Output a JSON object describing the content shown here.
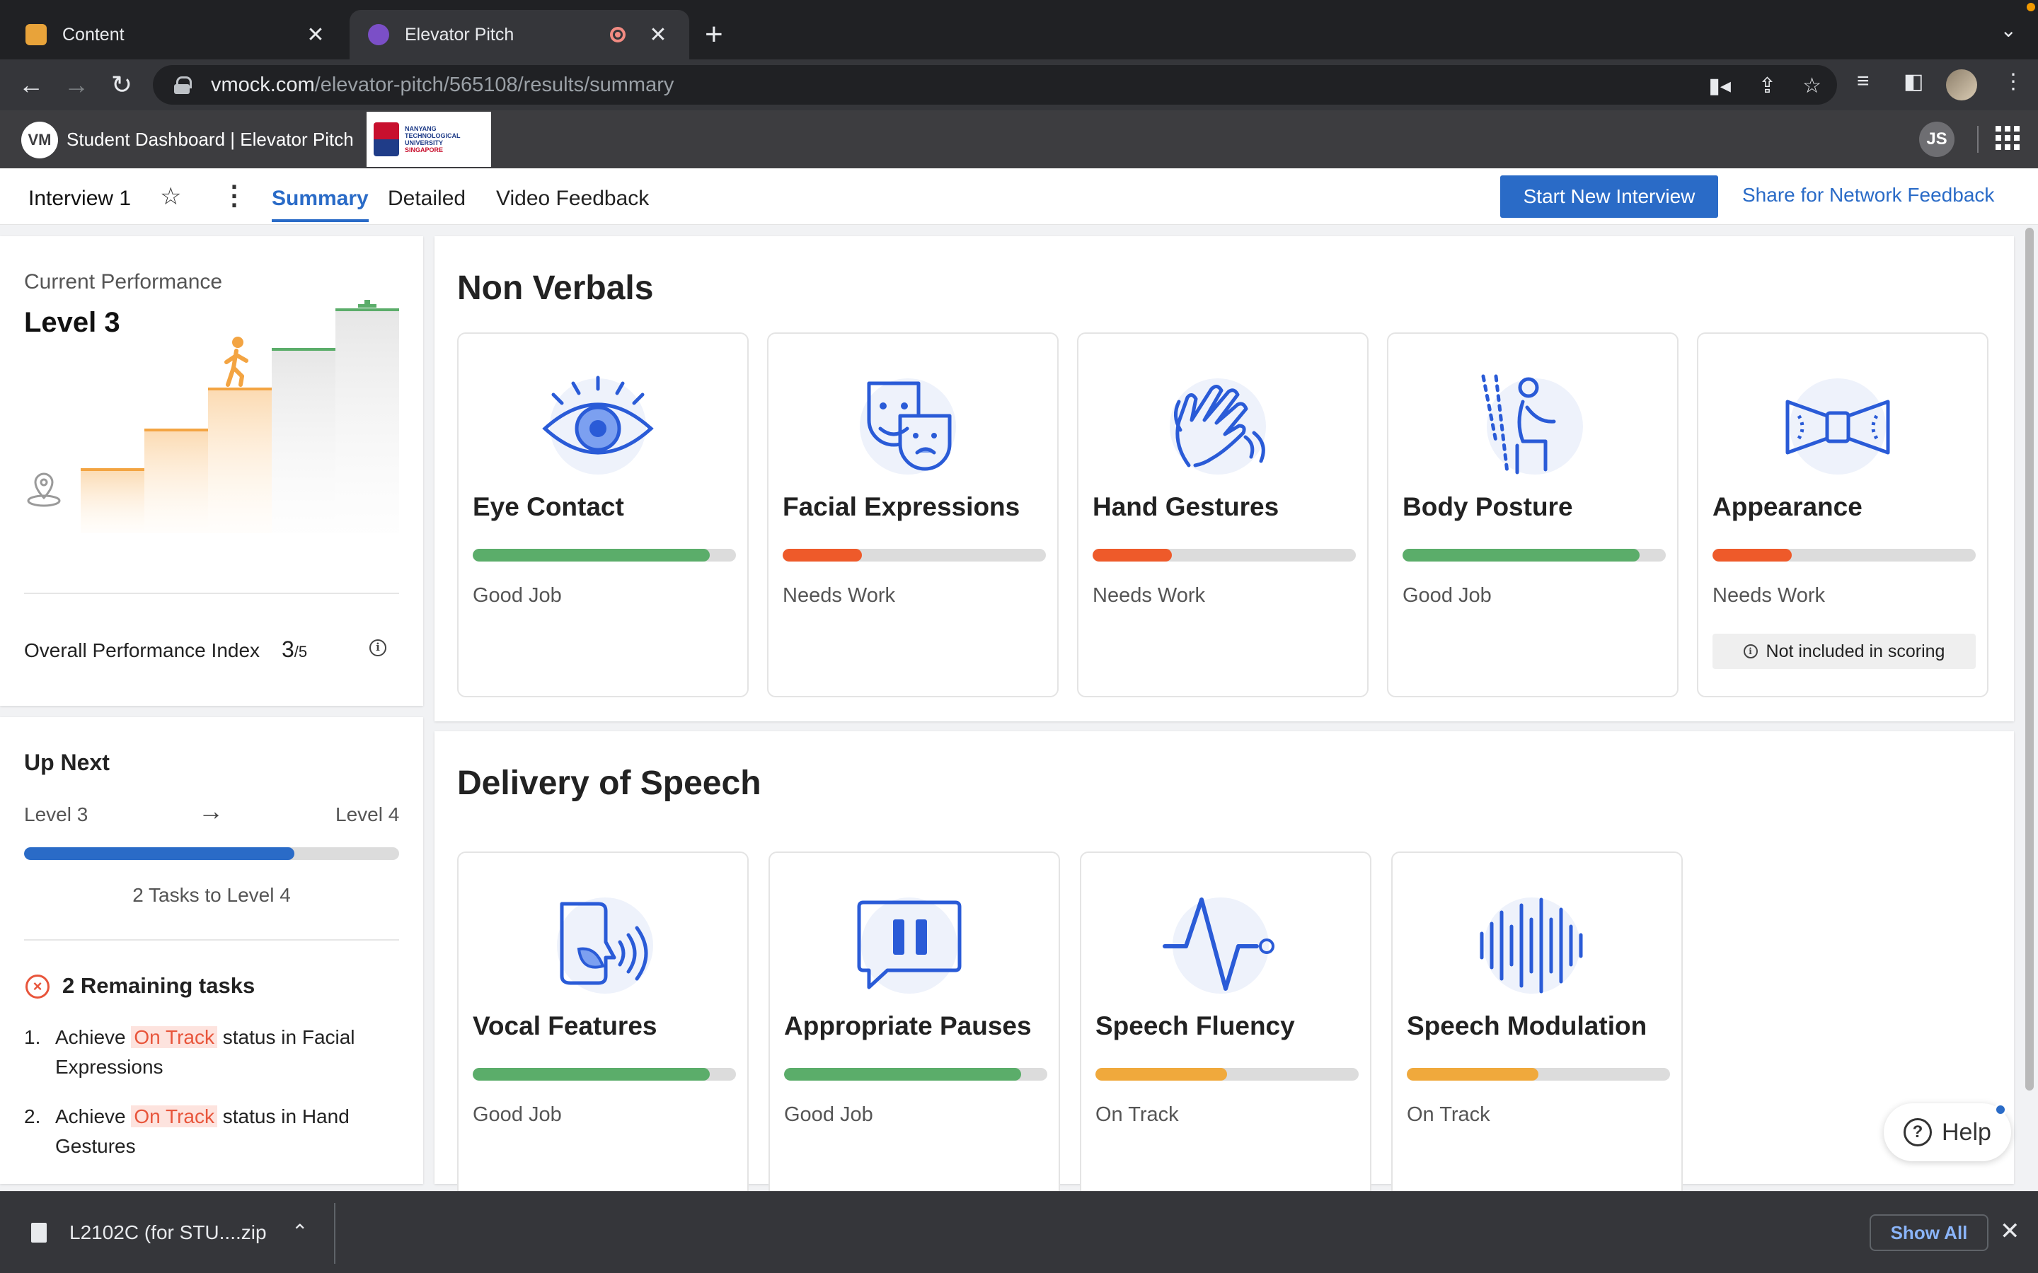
{
  "browser": {
    "tabs": [
      {
        "title": "Content",
        "active": false
      },
      {
        "title": "Elevator Pitch",
        "active": true
      }
    ],
    "url_host": "vmock.com",
    "url_path": "/elevator-pitch/565108/results/summary"
  },
  "app": {
    "logo_text": "VM",
    "title": "Student Dashboard | Elevator Pitch",
    "university": {
      "line1": "NANYANG",
      "line2": "TECHNOLOGICAL",
      "line3": "UNIVERSITY",
      "line4": "SINGAPORE"
    },
    "user_initials": "JS"
  },
  "subnav": {
    "interview_name": "Interview 1",
    "tabs": [
      "Summary",
      "Detailed",
      "Video Feedback"
    ],
    "active_tab": "Summary",
    "start_button": "Start New Interview",
    "share_link": "Share for Network Feedback"
  },
  "performance": {
    "label": "Current Performance",
    "level": "Level 3",
    "current_step": 3,
    "total_steps": 5,
    "opi_label": "Overall Performance Index",
    "opi_value": "3",
    "opi_max": "/5"
  },
  "up_next": {
    "title": "Up Next",
    "from": "Level 3",
    "to": "Level 4",
    "progress": 0.72,
    "tasks_to_level": "2 Tasks to Level 4",
    "remaining_title": "2 Remaining tasks",
    "tasks": [
      {
        "num": "1.",
        "prefix": "Achieve",
        "highlight": "On Track",
        "suffix": "status in Facial Expressions"
      },
      {
        "num": "2.",
        "prefix": "Achieve",
        "highlight": "On Track",
        "suffix": "status in Hand Gestures"
      }
    ]
  },
  "non_verbals": {
    "title": "Non Verbals",
    "metrics": [
      {
        "name": "Eye Contact",
        "status": "Good Job",
        "level": 0.9,
        "color": "#5bad6a",
        "icon": "eye-icon"
      },
      {
        "name": "Facial Expressions",
        "status": "Needs Work",
        "level": 0.3,
        "color": "#ee5a2a",
        "icon": "masks-icon"
      },
      {
        "name": "Hand Gestures",
        "status": "Needs Work",
        "level": 0.3,
        "color": "#ee5a2a",
        "icon": "hand-icon"
      },
      {
        "name": "Body Posture",
        "status": "Good Job",
        "level": 0.9,
        "color": "#5bad6a",
        "icon": "posture-icon"
      },
      {
        "name": "Appearance",
        "status": "Needs Work",
        "level": 0.3,
        "color": "#ee5a2a",
        "icon": "bowtie-icon",
        "note": "Not included in scoring"
      }
    ]
  },
  "delivery": {
    "title": "Delivery of Speech",
    "metrics": [
      {
        "name": "Vocal Features",
        "status": "Good Job",
        "level": 0.9,
        "color": "#5bad6a",
        "icon": "vocal-icon"
      },
      {
        "name": "Appropriate Pauses",
        "status": "Good Job",
        "level": 0.9,
        "color": "#5bad6a",
        "icon": "pause-icon"
      },
      {
        "name": "Speech Fluency",
        "status": "On Track",
        "level": 0.5,
        "color": "#f0a93c",
        "icon": "pulse-icon"
      },
      {
        "name": "Speech Modulation",
        "status": "On Track",
        "level": 0.5,
        "color": "#f0a93c",
        "icon": "waveform-icon"
      }
    ]
  },
  "help": {
    "label": "Help"
  },
  "download": {
    "filename": "L2102C (for STU....zip",
    "show_all": "Show All"
  }
}
